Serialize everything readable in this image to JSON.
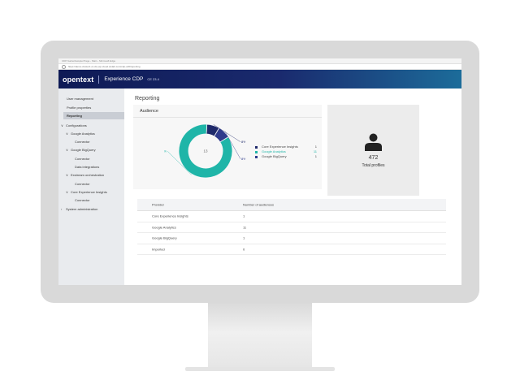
{
  "browser": {
    "tab_title": "CDP Gartenbeispiel Page - Main - Microsoft Edge",
    "url": "https://demo.cluster1.ot-dx-exp.cloud.otxlab.com/cdp-ui/#/reporting"
  },
  "header": {
    "brand": "opentext",
    "product": "Experience CDP",
    "version": "CE 23.4"
  },
  "sidebar": {
    "items": [
      {
        "label": "User management",
        "level": 0,
        "chevron": ""
      },
      {
        "label": "Profile properties",
        "level": 0,
        "chevron": ""
      },
      {
        "label": "Reporting",
        "level": 0,
        "chevron": "",
        "active": true
      },
      {
        "label": "Configurations",
        "level": 0,
        "chevron": "∨"
      },
      {
        "label": "Google Analytics",
        "level": 1,
        "chevron": "∨"
      },
      {
        "label": "Connector",
        "level": 2,
        "chevron": ""
      },
      {
        "label": "Google BigQuery",
        "level": 1,
        "chevron": "∨"
      },
      {
        "label": "Connector",
        "level": 2,
        "chevron": ""
      },
      {
        "label": "Data integrations",
        "level": 2,
        "chevron": ""
      },
      {
        "label": "Exstream orchestration",
        "level": 1,
        "chevron": "∨"
      },
      {
        "label": "Connector",
        "level": 2,
        "chevron": ""
      },
      {
        "label": "Core Experience Insights",
        "level": 1,
        "chevron": "∨"
      },
      {
        "label": "Connector",
        "level": 2,
        "chevron": ""
      },
      {
        "label": "System administration",
        "level": 0,
        "chevron": "›"
      }
    ]
  },
  "main": {
    "title": "Reporting",
    "audience": {
      "title": "Audience",
      "center_label": "13"
    },
    "profiles": {
      "count": "472",
      "label": "Total profiles",
      "icon": "person-icon"
    },
    "table": {
      "headers": [
        "Provider",
        "Number of audiences"
      ],
      "rows": [
        [
          "Core Experience Insights",
          "1"
        ],
        [
          "Google Analytics",
          "11"
        ],
        [
          "Google BigQuery",
          "1"
        ],
        [
          "Imported",
          "0"
        ]
      ]
    }
  },
  "chart_data": {
    "type": "pie",
    "donut": true,
    "categories": [
      "Core Experience Insights",
      "Google Analytics",
      "Google BigQuery"
    ],
    "values": [
      1,
      11,
      1
    ],
    "colors": [
      "#1f2a6b",
      "#1fb5a8",
      "#2e3a8c"
    ],
    "slice_labels": [
      "8%",
      "85%",
      "8%"
    ],
    "legend_values": [
      "1",
      "11",
      "1"
    ],
    "legend_position": "right"
  }
}
